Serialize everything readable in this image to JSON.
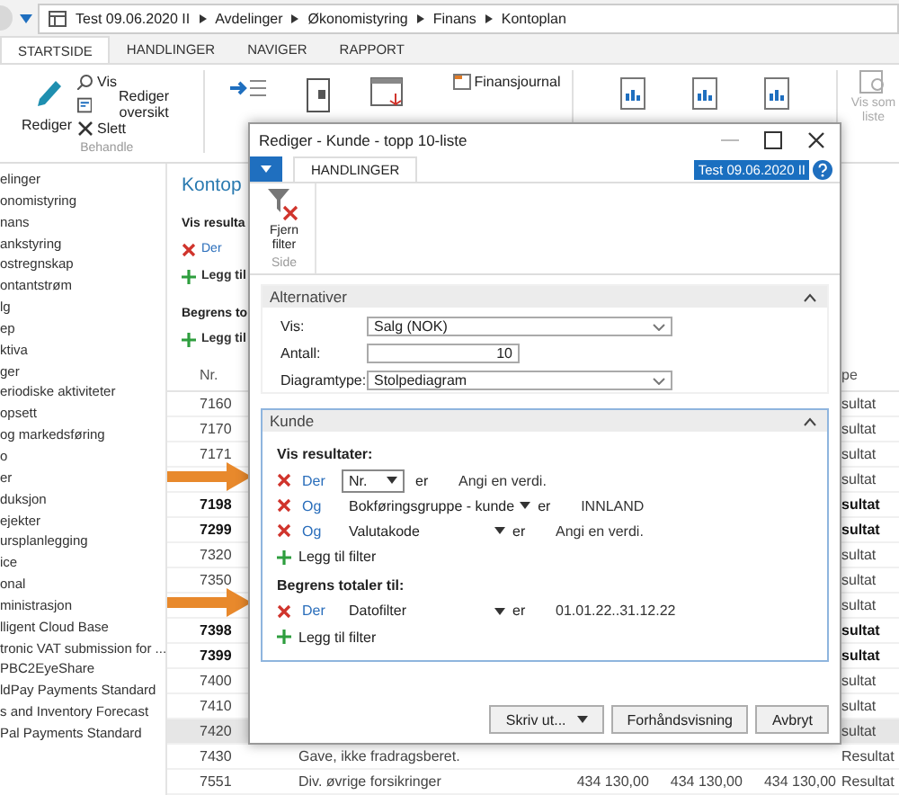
{
  "address_bar": {
    "crumbs": [
      "Test 09.06.2020 II",
      "Avdelinger",
      "Økonomistyring",
      "Finans",
      "Kontoplan"
    ]
  },
  "tabs": [
    {
      "label": "STARTSIDE",
      "selected": true
    },
    {
      "label": "HANDLINGER",
      "selected": false
    },
    {
      "label": "NAVIGER",
      "selected": false
    },
    {
      "label": "RAPPORT",
      "selected": false
    }
  ],
  "ribbon": {
    "edit": "Rediger",
    "small_actions": [
      "Vis",
      "Rediger oversikt",
      "Slett"
    ],
    "group_label": "Behandle",
    "journal": "Finansjournal",
    "list_view": {
      "label": "Vis som liste",
      "disabled": true
    }
  },
  "sidebar": {
    "items": [
      "elinger",
      "onomistyring",
      "nans",
      "ankstyring",
      "ostregnskap",
      "ontantstrøm",
      "lg",
      "ep",
      "ktiva",
      "ger",
      "eriodiske aktiviteter",
      "opsett",
      "og markedsføring",
      "o",
      "er",
      "duksjon",
      "ejekter",
      "ursplanlegging",
      "ice",
      "onal",
      "ministrasjon",
      "lligent Cloud Base",
      "tronic VAT submission for ...",
      "PBC2EyeShare",
      "ldPay Payments Standard",
      "s and Inventory Forecast",
      "Pal Payments Standard"
    ]
  },
  "page": {
    "title": "Kontop",
    "show_heading": "Vis resulta",
    "filter_conjunction": "Der",
    "add_filter": "Legg til",
    "limit_heading": "Begrens to",
    "add_filter_2": "Legg til"
  },
  "table": {
    "columns": [
      "Nr.",
      "pe"
    ],
    "rows": [
      {
        "nr": "7160",
        "type": "sultat",
        "bold": false,
        "selected": false
      },
      {
        "nr": "7170",
        "type": "sultat",
        "bold": false,
        "selected": false
      },
      {
        "nr": "7171",
        "type": "sultat",
        "bold": false,
        "selected": false
      },
      {
        "type": "sultat",
        "bold": false,
        "selected": false
      },
      {
        "nr": "7198",
        "type": "sultat",
        "bold": true,
        "selected": false
      },
      {
        "nr": "7299",
        "type": "sultat",
        "bold": true,
        "selected": false
      },
      {
        "nr": "7320",
        "type": "sultat",
        "bold": false,
        "selected": false
      },
      {
        "nr": "7350",
        "type": "sultat",
        "bold": false,
        "selected": false
      },
      {
        "type": "sultat",
        "bold": false,
        "selected": false
      },
      {
        "nr": "7398",
        "type": "sultat",
        "bold": true,
        "selected": false
      },
      {
        "nr": "7399",
        "type": "sultat",
        "bold": true,
        "selected": false
      },
      {
        "nr": "7400",
        "type": "sultat",
        "bold": false,
        "selected": false
      },
      {
        "nr": "7410",
        "type": "sultat",
        "bold": false,
        "selected": false
      },
      {
        "nr": "7420",
        "type": "sultat",
        "bold": false,
        "selected": true
      },
      {
        "nr": "7430",
        "description": "Gave, ikke fradragsberet.",
        "type": "Resultat",
        "bold": false,
        "selected": false
      },
      {
        "nr": "7551",
        "description": "Div. øvrige forsikringer",
        "amounts": [
          "434 130,00",
          "434 130,00",
          "434 130,00"
        ],
        "type": "Resultat",
        "bold": false,
        "selected": false
      }
    ]
  },
  "dialog": {
    "title": "Rediger - Kunde - topp 10-liste",
    "tab": "HANDLINGER",
    "company": "Test 09.06.2020 II",
    "action": "Fjern filter",
    "action_group": "Side",
    "sections": [
      {
        "kind": "options",
        "title": "Alternativer",
        "expanded": true,
        "focused": false,
        "fields": [
          {
            "label": "Vis:",
            "value": "Salg (NOK)",
            "kind": "dropdown"
          },
          {
            "label": "Antall:",
            "value": "10",
            "kind": "number"
          },
          {
            "label": "Diagramtype:",
            "value": "Stolpediagram",
            "kind": "dropdown"
          }
        ]
      },
      {
        "kind": "filters",
        "title": "Kunde",
        "expanded": true,
        "focused": true,
        "groups": [
          {
            "heading": "Vis resultater:",
            "add_label": "Legg til filter",
            "filters": [
              {
                "conjunction": "Der",
                "field": "Nr.",
                "focused": true,
                "operator": "er",
                "placeholder": "Angi en verdi."
              },
              {
                "conjunction": "Og",
                "field": "Bokføringsgruppe - kunde",
                "focused": false,
                "operator": "er",
                "value": "INNLAND"
              },
              {
                "conjunction": "Og",
                "field": "Valutakode",
                "focused": false,
                "operator": "er",
                "placeholder": "Angi en verdi."
              }
            ]
          },
          {
            "heading": "Begrens totaler til:",
            "add_label": "Legg til filter",
            "filters": [
              {
                "conjunction": "Der",
                "field": "Datofilter",
                "focused": false,
                "operator": "er",
                "value": "01.01.22..31.12.22"
              }
            ]
          }
        ]
      }
    ],
    "buttons": [
      {
        "label": "Skriv ut...",
        "dropdown": true
      },
      {
        "label": "Forhåndsvisning",
        "dropdown": false
      },
      {
        "label": "Avbryt",
        "dropdown": false
      }
    ]
  }
}
